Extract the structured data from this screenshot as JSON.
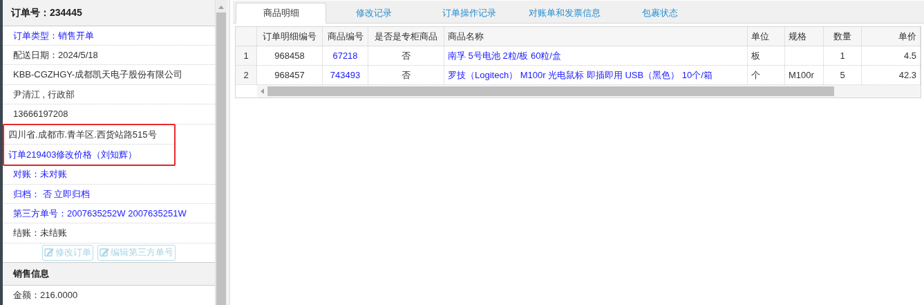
{
  "order_panel": {
    "title": "订单号：234445",
    "rows": [
      {
        "text": "订单类型：销售开单",
        "link": true,
        "highlighted": false
      },
      {
        "text": "配送日期：2024/5/18",
        "link": false,
        "highlighted": false
      },
      {
        "text": "KBB-CGZHGY-成都凯天电子股份有限公司",
        "link": false,
        "highlighted": false
      },
      {
        "text": "尹清江 , 行政部",
        "link": false,
        "highlighted": false
      },
      {
        "text": "13666197208",
        "link": false,
        "highlighted": false
      },
      {
        "text": "四川省.成都市.青羊区.西货站路515号",
        "link": false,
        "highlighted": true
      },
      {
        "text": "订单219403修改价格（刘知辉）",
        "link": true,
        "highlighted": true
      },
      {
        "text": "对账：未对账",
        "link": true,
        "highlighted": false
      },
      {
        "text": "归档：  否 立即归档",
        "link": true,
        "highlighted": false
      },
      {
        "text": "第三方单号：2007635252W 2007635251W",
        "link": true,
        "highlighted": false
      },
      {
        "text": "结账：未结账",
        "link": false,
        "highlighted": false
      }
    ],
    "buttons": [
      {
        "label": "修改订单",
        "disabled": true
      },
      {
        "label": "编辑第三方单号",
        "disabled": true
      }
    ],
    "section": {
      "title": "销售信息",
      "rows": [
        {
          "text": "金额：216.0000"
        }
      ]
    }
  },
  "tabs": [
    {
      "label": "商品明细",
      "selected": true
    },
    {
      "label": "修改记录",
      "selected": false
    },
    {
      "label": "订单操作记录",
      "selected": false
    },
    {
      "label": "对账单和发票信息",
      "selected": false
    },
    {
      "label": "包裹状态",
      "selected": false
    }
  ],
  "table": {
    "columns": [
      {
        "label": "订单明细编号",
        "link": false
      },
      {
        "label": "商品编号",
        "link": true
      },
      {
        "label": "是否是专柜商品",
        "link": false
      },
      {
        "label": "商品名称",
        "link": true
      },
      {
        "label": "单位",
        "link": false
      },
      {
        "label": "规格",
        "link": false
      },
      {
        "label": "数量",
        "link": false
      },
      {
        "label": "单价",
        "link": false
      }
    ],
    "rows": [
      {
        "number": "1",
        "cells": [
          "968458",
          "67218",
          "否",
          "南孚 5号电池 2粒/板 60粒/盒",
          "板",
          "",
          "1",
          "4.5"
        ]
      },
      {
        "number": "2",
        "cells": [
          "968457",
          "743493",
          "否",
          "罗技（Logitech） M100r 光电鼠标 即插即用 USB（黑色） 10个/箱",
          "个",
          "M100r",
          "5",
          "42.3"
        ]
      }
    ]
  }
}
